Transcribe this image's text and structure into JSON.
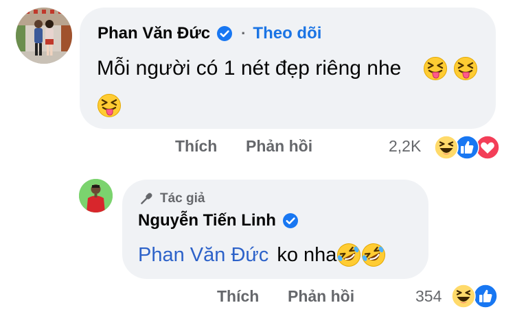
{
  "comment": {
    "author": "Phan Văn Đức",
    "separator": "·",
    "follow_label": "Theo dõi",
    "text": "Mỗi người có 1 nét đẹp riêng nhe",
    "emojis": [
      "squinting-tongue-emoji",
      "squinting-tongue-emoji",
      "squinting-tongue-emoji"
    ],
    "actions": {
      "like": "Thích",
      "reply": "Phản hồi"
    },
    "reaction_count": "2,2K",
    "reactions": [
      "haha-reaction",
      "like-reaction",
      "love-reaction"
    ]
  },
  "reply": {
    "tag": "Tác giả",
    "author": "Nguyễn Tiến Linh",
    "mention": "Phan Văn Đức",
    "text": "ko nha",
    "emojis": [
      "rolling-on-floor-laughing-emoji",
      "rolling-on-floor-laughing-emoji"
    ],
    "actions": {
      "like": "Thích",
      "reply": "Phản hồi"
    },
    "reaction_count": "354",
    "reactions": [
      "haha-reaction",
      "like-reaction"
    ]
  },
  "colors": {
    "bubble": "#f0f2f5",
    "text": "#050505",
    "secondary": "#65676b",
    "link": "#1b74e4",
    "mention": "#2d62c9",
    "verified": "#1877f2"
  }
}
